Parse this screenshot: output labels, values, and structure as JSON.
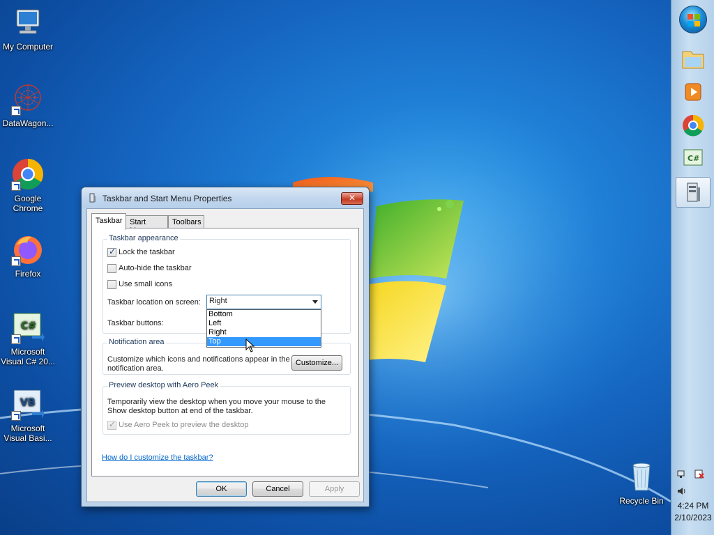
{
  "desktop": {
    "icons": [
      {
        "label": "My Computer"
      },
      {
        "label": "DataWagon..."
      },
      {
        "label": "Google Chrome"
      },
      {
        "label": "Firefox"
      },
      {
        "label": "Microsoft Visual C# 20..."
      },
      {
        "label": "Microsoft Visual Basi..."
      },
      {
        "label": "Recycle Bin"
      }
    ]
  },
  "taskbar": {
    "position": "right",
    "pinned": [
      "start-orb",
      "windows-explorer",
      "media-player",
      "chrome",
      "visual-csharp",
      "taskbar-properties"
    ],
    "clock": {
      "time": "4:24 PM",
      "date": "2/10/2023"
    }
  },
  "dialog": {
    "title": "Taskbar and Start Menu Properties",
    "close_glyph": "✕",
    "tabs": [
      "Taskbar",
      "Start Menu",
      "Toolbars"
    ],
    "selected_tab": "Taskbar",
    "appearance": {
      "title": "Taskbar appearance",
      "lock_label": "Lock the taskbar",
      "lock_checked": true,
      "autohide_label": "Auto-hide the taskbar",
      "autohide_checked": false,
      "small_icons_label": "Use small icons",
      "small_icons_checked": false,
      "location_label": "Taskbar location on screen:",
      "location_value": "Right",
      "location_options": [
        "Bottom",
        "Left",
        "Right",
        "Top"
      ],
      "location_highlighted": "Top",
      "buttons_label": "Taskbar buttons:"
    },
    "notification": {
      "title": "Notification area",
      "text_line1": "Customize which icons and notifications appear in the",
      "text_line2": "notification area.",
      "customize_label": "Customize..."
    },
    "aero_peek": {
      "title": "Preview desktop with Aero Peek",
      "text_line1": "Temporarily view the desktop when you move your mouse to the",
      "text_line2": "Show desktop button at end of the taskbar.",
      "checkbox_label": "Use Aero Peek to preview the desktop",
      "checked": true,
      "disabled": true
    },
    "help_link": "How do I customize the taskbar?",
    "ok_label": "OK",
    "cancel_label": "Cancel",
    "apply_label": "Apply"
  },
  "colors": {
    "desktop_blue": "#1565c0",
    "selection_blue": "#3399ff",
    "link_blue": "#0066cc",
    "close_red": "#c23a22"
  }
}
